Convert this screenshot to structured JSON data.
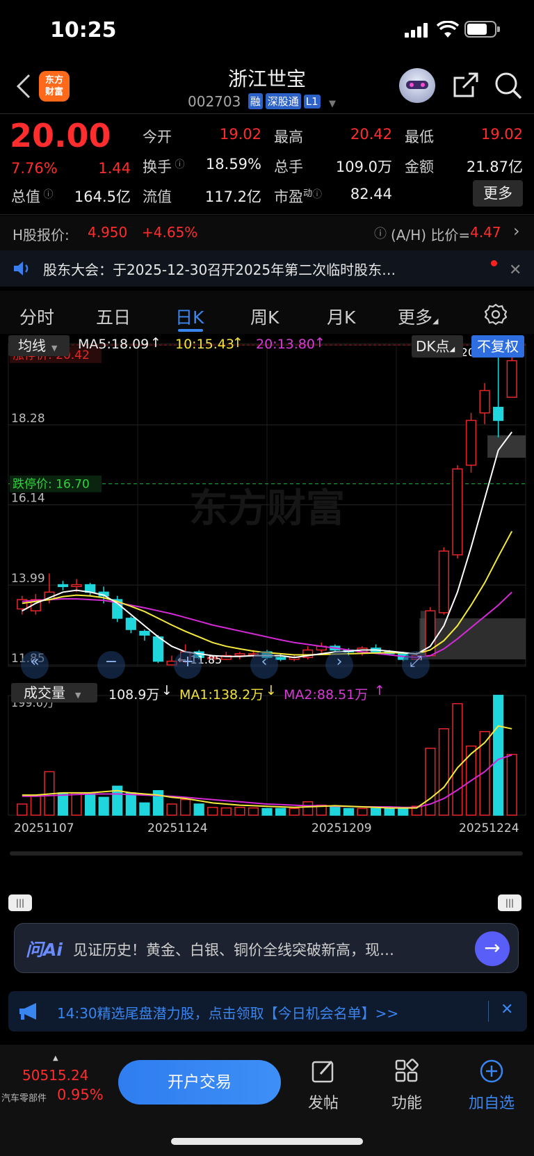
{
  "status": {
    "time": "10:25"
  },
  "header": {
    "logo": "东方\n财富",
    "stock_name": "浙江世宝",
    "code": "002703",
    "tags": [
      "融",
      "深股通",
      "L1"
    ]
  },
  "quote": {
    "price": "20.00",
    "change_pct": "7.76%",
    "change": "1.44",
    "open_label": "今开",
    "open": "19.02",
    "high_label": "最高",
    "high": "20.42",
    "low_label": "最低",
    "low": "19.02",
    "turnover_label": "换手",
    "turnover": "18.59%",
    "volume_label": "总手",
    "volume": "109.0万",
    "amount_label": "金额",
    "amount": "21.87亿",
    "mktcap_label": "总值",
    "mktcap": "164.5亿",
    "float_label": "流值",
    "float": "117.2亿",
    "pe_label": "市盈",
    "pe_sup": "动",
    "pe": "82.44",
    "more": "更多"
  },
  "hshare": {
    "label": "H股报价:",
    "price": "4.950",
    "pct": "+4.65%",
    "ratio_label": "(A/H) 比价=",
    "ratio": "4.47"
  },
  "notice": {
    "text": "股东大会：于2025-12-30召开2025年第二次临时股东…"
  },
  "tabs": [
    "分时",
    "五日",
    "日K",
    "周K",
    "月K",
    "更多"
  ],
  "chart": {
    "ma_label": "均线",
    "ma5": "MA5:18.09",
    "ma10": "10:15.43",
    "ma20": "20:13.80",
    "dk": "DK点",
    "fq": "不复权",
    "limit_up": "涨停价: 20.42",
    "limit_down": "跌停价: 16.70",
    "high_mark": "20.42",
    "low_mark": "11.85",
    "watermark": "东方财富",
    "vol_label": "成交量",
    "vol_now": "108.9万",
    "vol_ma1": "MA1:138.2万",
    "vol_ma2": "MA2:88.51万",
    "vol_max": "199.6万",
    "colors": {
      "up": "#e8262a",
      "down": "#1fd6dc",
      "ma5": "#ffffff",
      "ma10": "#f5ea3c",
      "ma20": "#d42ad6"
    }
  },
  "chart_data": {
    "type": "candlestick",
    "y_ticks": [
      "20.42",
      "18.28",
      "16.14",
      "13.99",
      "11.85"
    ],
    "x_ticks": [
      "20251107",
      "20251124",
      "20251209",
      "20251224"
    ],
    "ylim": [
      11.85,
      20.42
    ],
    "vol_max": 199.6,
    "candles": [
      [
        13.35,
        13.6,
        13.7,
        13.2,
        20
      ],
      [
        13.3,
        13.6,
        13.75,
        13.2,
        34
      ],
      [
        13.6,
        13.8,
        14.3,
        13.5,
        78
      ],
      [
        14.0,
        13.95,
        14.1,
        13.85,
        40
      ],
      [
        13.95,
        14.0,
        14.15,
        13.8,
        40
      ],
      [
        14.0,
        13.8,
        14.05,
        13.7,
        40
      ],
      [
        13.8,
        13.7,
        13.95,
        13.5,
        32
      ],
      [
        13.6,
        13.1,
        13.7,
        13.0,
        52
      ],
      [
        13.1,
        12.8,
        13.15,
        12.7,
        40
      ],
      [
        12.75,
        12.65,
        12.8,
        12.5,
        22
      ],
      [
        12.6,
        11.95,
        12.65,
        11.9,
        44
      ],
      [
        11.85,
        11.95,
        12.1,
        11.85,
        20
      ],
      [
        11.95,
        12.2,
        12.4,
        11.9,
        28
      ],
      [
        12.2,
        12.05,
        12.25,
        12.0,
        20
      ],
      [
        12.05,
        12.05,
        12.1,
        11.95,
        14
      ],
      [
        12.0,
        12.1,
        12.2,
        11.98,
        13
      ],
      [
        12.1,
        12.15,
        12.2,
        12.0,
        14
      ],
      [
        12.15,
        12.15,
        12.25,
        12.05,
        13
      ],
      [
        12.2,
        12.05,
        12.25,
        12.0,
        12
      ],
      [
        12.05,
        12.0,
        12.15,
        11.95,
        12
      ],
      [
        12.0,
        12.05,
        12.1,
        11.95,
        12
      ],
      [
        12.05,
        12.25,
        12.35,
        12.0,
        24
      ],
      [
        12.25,
        12.35,
        12.45,
        12.15,
        18
      ],
      [
        12.35,
        12.25,
        12.4,
        12.2,
        15
      ],
      [
        12.25,
        12.2,
        12.3,
        12.1,
        12
      ],
      [
        12.2,
        12.3,
        12.35,
        12.1,
        12
      ],
      [
        12.3,
        12.2,
        12.4,
        12.15,
        12
      ],
      [
        12.2,
        12.15,
        12.25,
        12.1,
        12
      ],
      [
        12.15,
        12.0,
        12.2,
        11.95,
        12
      ],
      [
        12.0,
        12.1,
        12.2,
        11.95,
        16
      ],
      [
        12.1,
        13.3,
        13.4,
        12.1,
        120
      ],
      [
        13.25,
        14.9,
        15.0,
        13.2,
        155
      ],
      [
        14.8,
        17.1,
        17.2,
        14.7,
        200
      ],
      [
        17.2,
        18.4,
        18.6,
        17.0,
        124
      ],
      [
        18.6,
        19.2,
        19.4,
        18.3,
        150
      ],
      [
        18.75,
        18.4,
        20.42,
        17.95,
        215
      ],
      [
        19.02,
        20.0,
        20.42,
        19.02,
        109
      ]
    ],
    "ma5": [
      13.3,
      13.5,
      13.65,
      13.8,
      13.85,
      13.8,
      13.72,
      13.5,
      13.2,
      12.9,
      12.6,
      12.35,
      12.2,
      12.15,
      12.1,
      12.08,
      12.08,
      12.1,
      12.1,
      12.1,
      12.05,
      12.1,
      12.15,
      12.2,
      12.22,
      12.25,
      12.25,
      12.22,
      12.18,
      12.14,
      12.35,
      12.9,
      13.8,
      15.0,
      16.3,
      17.6,
      18.09
    ],
    "ma10": [
      13.5,
      13.55,
      13.6,
      13.68,
      13.72,
      13.7,
      13.65,
      13.55,
      13.42,
      13.28,
      13.1,
      12.92,
      12.75,
      12.6,
      12.45,
      12.35,
      12.28,
      12.22,
      12.18,
      12.15,
      12.12,
      12.12,
      12.13,
      12.14,
      12.15,
      12.16,
      12.17,
      12.18,
      12.17,
      12.15,
      12.25,
      12.5,
      12.9,
      13.45,
      14.05,
      14.75,
      15.43
    ],
    "ma20": [
      13.55,
      13.58,
      13.6,
      13.62,
      13.62,
      13.6,
      13.58,
      13.52,
      13.45,
      13.38,
      13.3,
      13.22,
      13.12,
      13.02,
      12.92,
      12.84,
      12.76,
      12.68,
      12.6,
      12.52,
      12.45,
      12.4,
      12.35,
      12.3,
      12.25,
      12.2,
      12.16,
      12.12,
      12.08,
      12.05,
      12.1,
      12.28,
      12.55,
      12.85,
      13.15,
      13.45,
      13.8
    ],
    "vol_ma1": [
      36,
      36,
      38,
      40,
      40,
      40,
      42,
      44,
      40,
      38,
      36,
      32,
      30,
      26,
      22,
      20,
      18,
      17,
      16,
      15,
      14,
      15,
      16,
      17,
      16,
      15,
      14,
      13,
      13,
      13,
      30,
      50,
      85,
      110,
      130,
      160,
      155
    ],
    "vol_ma2": [
      34,
      34,
      35,
      36,
      37,
      38,
      38,
      38,
      37,
      36,
      35,
      34,
      32,
      30,
      28,
      26,
      24,
      22,
      20,
      19,
      18,
      17,
      17,
      16,
      16,
      15,
      15,
      15,
      14,
      14,
      20,
      30,
      45,
      62,
      78,
      100,
      108
    ]
  },
  "ai": {
    "brand": "问Ai",
    "text": "见证历史！黄金、白银、铜价全线突破新高，现…"
  },
  "promo": {
    "text": "14:30精选尾盘潜力股，点击领取【今日机会名单】>>"
  },
  "bottom": {
    "index_value": "50515.24",
    "index_name": "汽车零部件",
    "index_pct": "0.95%",
    "trade": "开户交易",
    "post": "发帖",
    "func": "功能",
    "add": "加自选"
  }
}
